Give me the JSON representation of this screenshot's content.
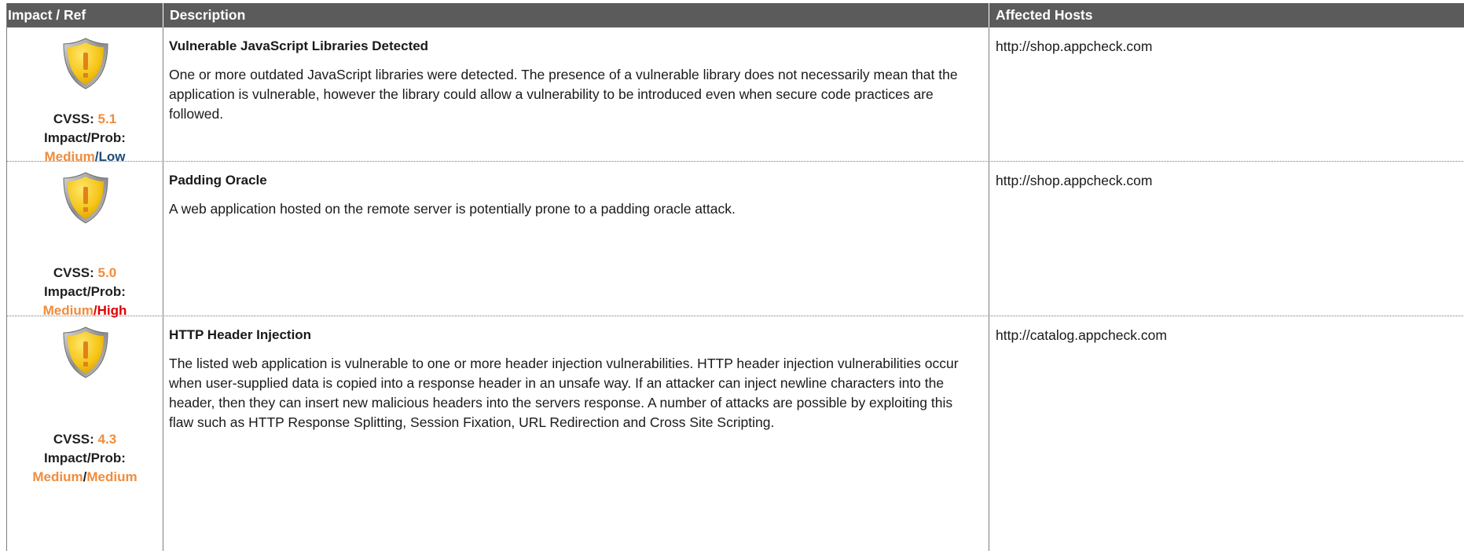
{
  "header": {
    "col_impact": "Impact / Ref",
    "col_description": "Description",
    "col_hosts": "Affected Hosts"
  },
  "labels": {
    "cvss": "CVSS:",
    "impact_prob": "Impact/Prob:",
    "slash": "/"
  },
  "colors": {
    "header_bg": "#5b5b5b",
    "medium": "#f08c3c",
    "low": "#1f4e79",
    "high": "#e00000",
    "shield_gold": "#f5c518"
  },
  "findings": [
    {
      "icon": "warning-shield-icon",
      "cvss": "5.1",
      "impact": "Medium",
      "prob": "Low",
      "title": "Vulnerable JavaScript Libraries Detected",
      "description": "One or more outdated JavaScript libraries were detected. The presence of a vulnerable library does not necessarily mean that the application is vulnerable, however the library could allow a vulnerability to be introduced even when secure code practices are followed.",
      "host": "http://shop.appcheck.com"
    },
    {
      "icon": "warning-shield-icon",
      "cvss": "5.0",
      "impact": "Medium",
      "prob": "High",
      "title": "Padding Oracle",
      "description": "A web application hosted on the remote server is potentially prone to a padding oracle attack.",
      "host": "http://shop.appcheck.com"
    },
    {
      "icon": "warning-shield-icon",
      "cvss": "4.3",
      "impact": "Medium",
      "prob": "Medium",
      "title": "HTTP Header Injection",
      "description": "The listed web application is vulnerable to one or more header injection vulnerabilities.  HTTP header injection vulnerabilities occur when user-supplied data is copied into a response header in an unsafe way. If an attacker can inject newline characters into the header, then they can insert new malicious headers into the servers response. A number of attacks are possible by exploiting this flaw such as HTTP Response Splitting, Session Fixation, URL Redirection and Cross Site Scripting.",
      "host": "http://catalog.appcheck.com"
    }
  ]
}
